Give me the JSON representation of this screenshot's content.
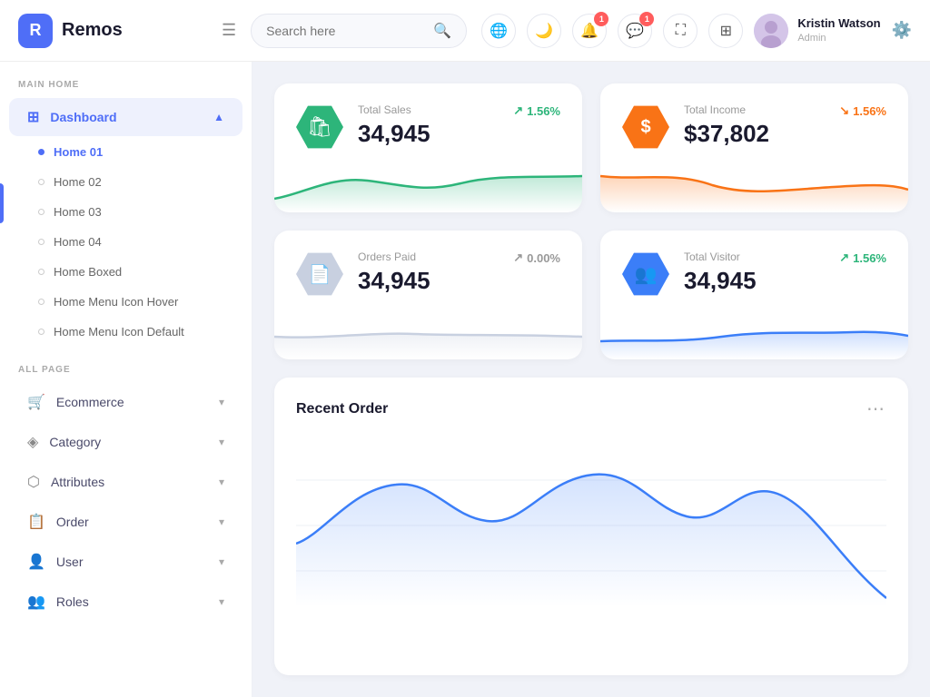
{
  "app": {
    "logo_letter": "R",
    "logo_name": "Remos"
  },
  "header": {
    "search_placeholder": "Search here",
    "notifications_badge": "1",
    "messages_badge": "1",
    "user_name": "Kristin Watson",
    "user_role": "Admin"
  },
  "sidebar": {
    "section_main": "MAIN HOME",
    "section_all": "ALL PAGE",
    "dashboard_label": "Dashboard",
    "sub_items": [
      {
        "label": "Home 01",
        "active": true
      },
      {
        "label": "Home 02",
        "active": false
      },
      {
        "label": "Home 03",
        "active": false
      },
      {
        "label": "Home 04",
        "active": false
      },
      {
        "label": "Home Boxed",
        "active": false
      },
      {
        "label": "Home Menu Icon Hover",
        "active": false
      },
      {
        "label": "Home Menu Icon Default",
        "active": false
      }
    ],
    "nav_items": [
      {
        "label": "Ecommerce",
        "icon": "🛒"
      },
      {
        "label": "Category",
        "icon": "⬡"
      },
      {
        "label": "Attributes",
        "icon": "📦"
      },
      {
        "label": "Order",
        "icon": "📋"
      },
      {
        "label": "User",
        "icon": "👤"
      },
      {
        "label": "Roles",
        "icon": "👥"
      }
    ]
  },
  "stats": [
    {
      "label": "Total Sales",
      "value": "34,945",
      "change": "1.56%",
      "direction": "up",
      "icon_color": "green",
      "icon_symbol": "🛍"
    },
    {
      "label": "Total Income",
      "value": "$37,802",
      "change": "1.56%",
      "direction": "down",
      "icon_color": "orange",
      "icon_symbol": "$"
    },
    {
      "label": "Orders Paid",
      "value": "34,945",
      "change": "0.00%",
      "direction": "neutral",
      "icon_color": "gray",
      "icon_symbol": "📄"
    },
    {
      "label": "Total Visitor",
      "value": "34,945",
      "change": "1.56%",
      "direction": "up",
      "icon_color": "blue",
      "icon_symbol": "👥"
    }
  ],
  "recent_order": {
    "title": "Recent Order",
    "dots_label": "⋯"
  }
}
